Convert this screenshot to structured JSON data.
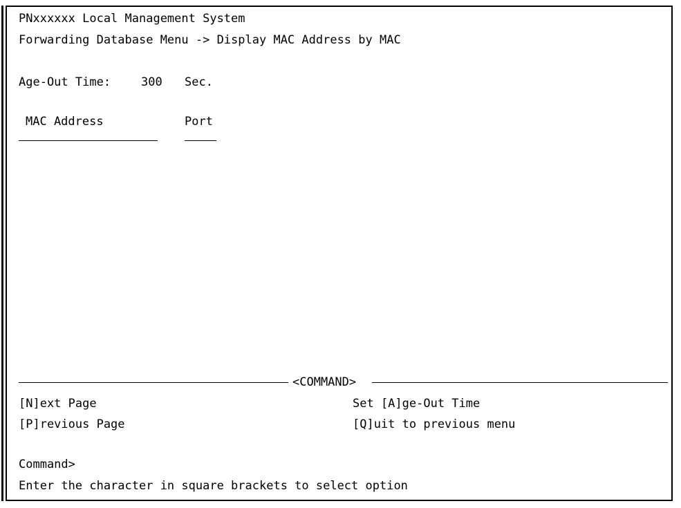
{
  "header": {
    "system_title": "PNxxxxxx Local Management System",
    "breadcrumb": "Forwarding Database Menu -> Display MAC Address by MAC"
  },
  "age_out": {
    "label": "Age-Out Time:",
    "value": "300",
    "unit": "Sec."
  },
  "table": {
    "columns": [
      "MAC Address",
      "Port"
    ],
    "rows": []
  },
  "command_section": {
    "title": "<COMMAND>",
    "options": {
      "next_page": "[N]ext Page",
      "set_age_out": "Set [A]ge-Out Time",
      "previous_page": "[P]revious Page",
      "quit": "[Q]uit to previous menu"
    }
  },
  "prompt": {
    "label": "Command>",
    "help": "Enter the character in square brackets to select option"
  }
}
